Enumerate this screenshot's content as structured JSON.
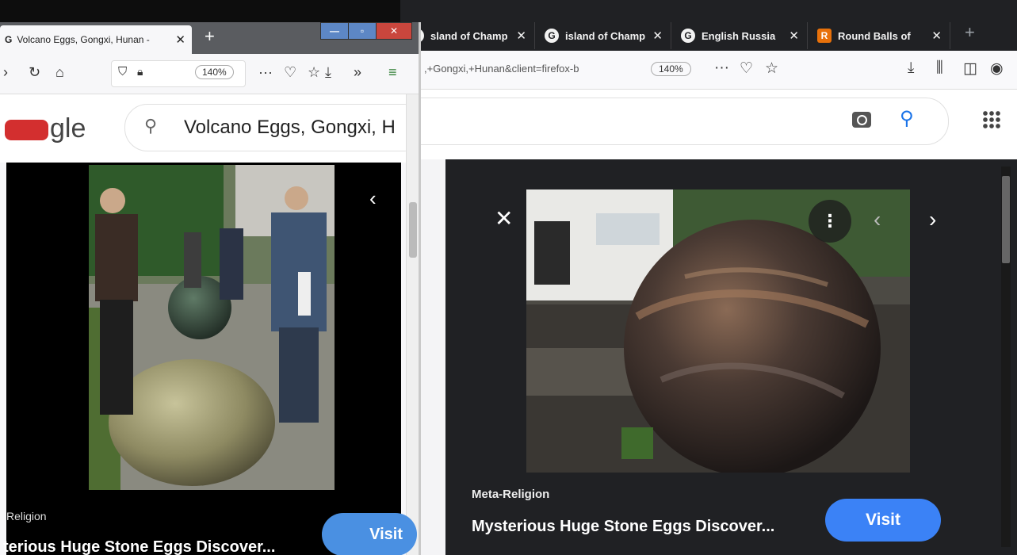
{
  "right_window": {
    "tabs": [
      {
        "favicon": "globe-icon",
        "title": "sland of Champ",
        "close": "✕"
      },
      {
        "favicon": "google-g-icon",
        "title": "island of Champ",
        "close": "✕"
      },
      {
        "favicon": "google-g-icon",
        "title": "English Russia",
        "close": "✕"
      },
      {
        "favicon": "r-logo-icon",
        "title": "Round Balls of",
        "close": "✕"
      }
    ],
    "new_tab": "+",
    "url_fragment": ",+Gongxi,+Hunan&client=firefox-b",
    "zoom": "140%",
    "image_viewer": {
      "close": "✕",
      "more": "⋮",
      "prev": "‹",
      "next": "›",
      "source": "Meta-Religion",
      "headline": "Mysterious Huge Stone Eggs Discover...",
      "visit": "Visit"
    }
  },
  "left_window": {
    "tab_title": "Volcano Eggs, Gongxi, Hunan -",
    "tab_favicon": "G",
    "tab_close": "✕",
    "new_tab": "+",
    "zoom": "140%",
    "logo_text": "gle",
    "search_query": "Volcano Eggs, Gongxi, H",
    "image_viewer": {
      "prev": "‹",
      "source": "Religion",
      "headline": "terious Huge Stone Eggs Discover...",
      "visit": "Visit"
    }
  },
  "colors": {
    "accent": "#3b82f6",
    "viewer_bg": "#202124",
    "tabbar": "#202124"
  }
}
